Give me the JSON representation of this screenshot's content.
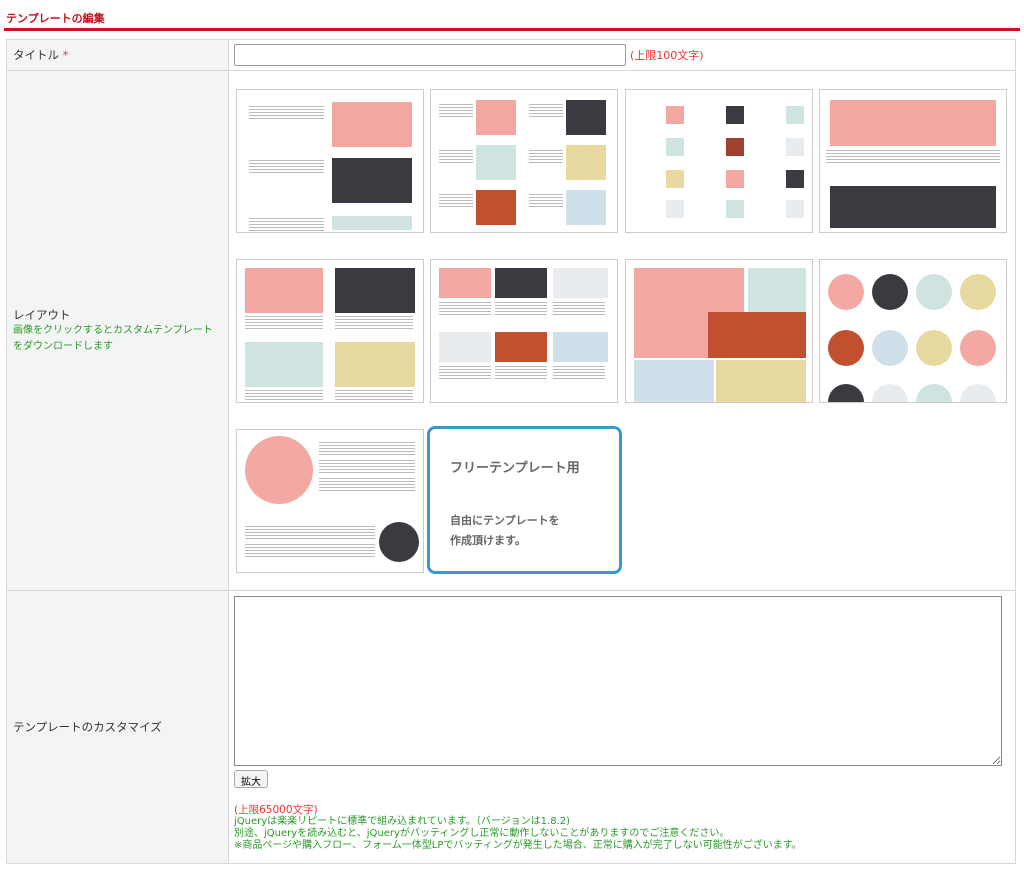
{
  "header": {
    "title": "テンプレートの編集"
  },
  "title_row": {
    "label": "タイトル",
    "required": "*",
    "value": "",
    "limit": "(上限100文字)"
  },
  "layout_row": {
    "label": "レイアウト",
    "note": "画像をクリックするとカスタムテンプレートをダウンロードします",
    "thumbnails": [
      "template-1",
      "template-2",
      "template-3",
      "template-4",
      "template-5",
      "template-6",
      "template-7",
      "template-8",
      "template-9"
    ],
    "free_template": {
      "title": "フリーテンプレート用",
      "desc": "自由にテンプレートを\n作成頂けます。"
    }
  },
  "customize_row": {
    "label": "テンプレートのカスタマイズ",
    "value": "",
    "expand_button": "拡大",
    "limit": "(上限65000文字)",
    "notes": [
      "jQueryは楽楽リピートに標準で組み込まれています。（バージョンは1.8.2)",
      "別途、jQueryを読み込むと、jQueryがバッティングし正常に動作しないことがありますのでご注意ください。",
      "※商品ページや購入フロー、フォーム一体型LPでバッティングが発生した場合、正常に購入が完了しない可能性がございます。"
    ]
  },
  "colors": {
    "accent": "#d0101c",
    "note_green": "#2a9a2a",
    "limit_red": "#f03030",
    "free_border": "#3a97d0"
  }
}
